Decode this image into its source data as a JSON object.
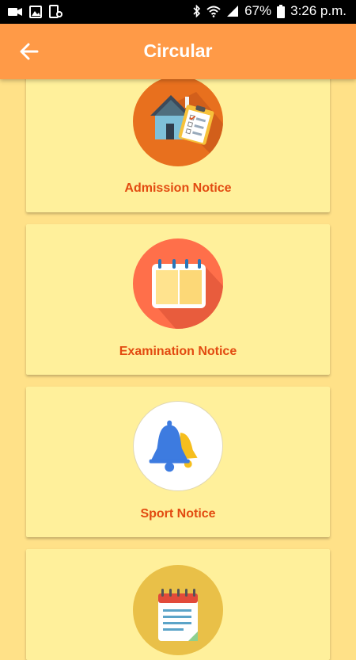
{
  "status_bar": {
    "battery": "67%",
    "time": "3:26 p.m.",
    "icons": [
      "video-camera-icon",
      "image-icon",
      "phone-tablet-icon",
      "bluetooth-icon",
      "wifi-icon",
      "signal-icon",
      "battery-icon"
    ]
  },
  "app_bar": {
    "title": "Circular",
    "back_icon": "arrow-left-icon"
  },
  "cards": [
    {
      "label": "Admission Notice",
      "icon": "school-admission-icon",
      "circle_color": "#E8701E"
    },
    {
      "label": "Examination Notice",
      "icon": "calendar-icon",
      "circle_color": "#FF6F4A"
    },
    {
      "label": "Sport Notice",
      "icon": "bell-icon",
      "circle_color": "#FFFFFF"
    },
    {
      "label": "",
      "icon": "notepad-icon",
      "circle_color": "#E9C048"
    }
  ],
  "colors": {
    "background": "#FFE188",
    "app_bar": "#FF9A47",
    "card": "#FFF09B",
    "label": "#E24A10"
  }
}
